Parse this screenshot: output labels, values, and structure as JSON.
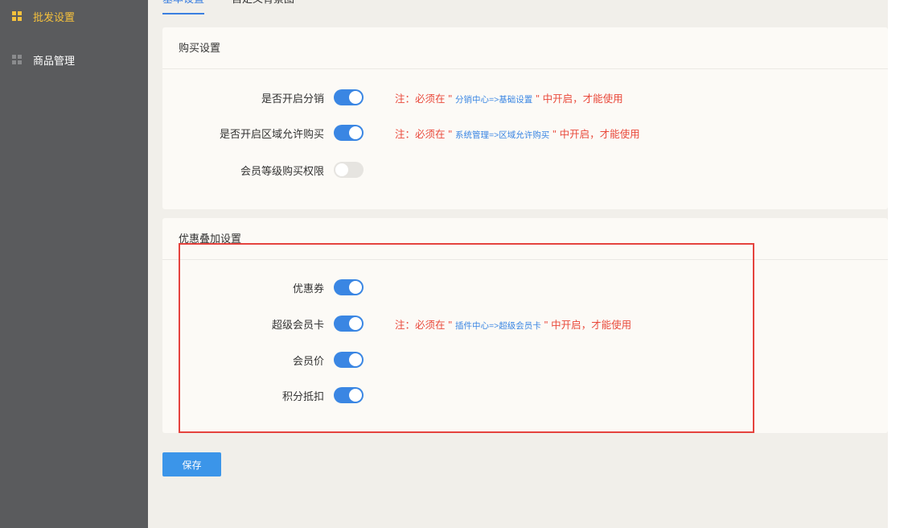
{
  "sidebar": {
    "items": [
      {
        "label": "批发设置",
        "active": true
      },
      {
        "label": "商品管理",
        "active": false
      }
    ]
  },
  "tabs": [
    "基本设置",
    "自定义背景图"
  ],
  "purchase": {
    "title": "购买设置",
    "rows": [
      {
        "label": "是否开启分销",
        "on": true,
        "note_prefix": "注：必须在",
        "note_path": "分销中心=>基础设置",
        "note_suffix": "中开启，才能使用"
      },
      {
        "label": "是否开启区域允许购买",
        "on": true,
        "note_prefix": "注：必须在",
        "note_path": "系统管理=>区域允许购买",
        "note_suffix": "中开启，才能使用"
      },
      {
        "label": "会员等级购买权限",
        "on": false
      }
    ]
  },
  "discount": {
    "title": "优惠叠加设置",
    "rows": [
      {
        "label": "优惠券",
        "on": true
      },
      {
        "label": "超级会员卡",
        "on": true,
        "note_prefix": "注：必须在",
        "note_path": "插件中心=>超级会员卡",
        "note_suffix": "中开启，才能使用"
      },
      {
        "label": "会员价",
        "on": true
      },
      {
        "label": "积分抵扣",
        "on": true
      }
    ]
  },
  "save_label": "保存",
  "colors": {
    "accent": "#3a86e3",
    "warning": "#e9493b",
    "sidebar_active": "#f5c13c",
    "highlight": "#e5433e"
  }
}
